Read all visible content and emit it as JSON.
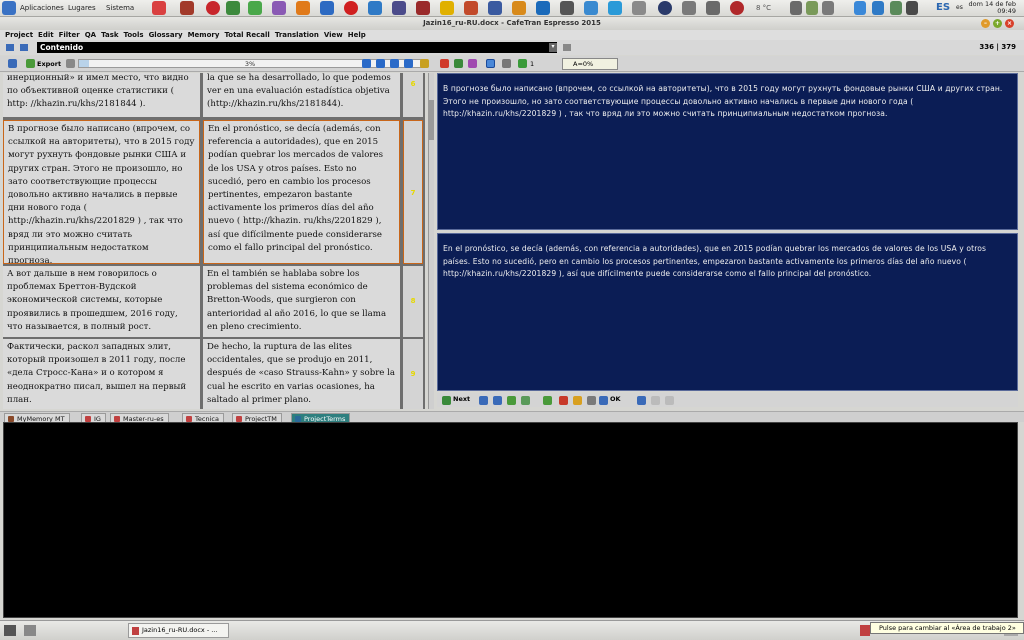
{
  "panel": {
    "menus": [
      "Aplicaciones",
      "Lugares",
      "Sistema"
    ],
    "weather": "8 °C",
    "keyboard": "ES",
    "language": "es",
    "date": "dom 14 de feb",
    "time": "09:49"
  },
  "window": {
    "title": "Jazin16_ru-RU.docx - CafeTran Espresso 2015"
  },
  "menu": [
    "Project",
    "Edit",
    "Filter",
    "QA",
    "Task",
    "Tools",
    "Glossary",
    "Memory",
    "Total Recall",
    "Translation",
    "View",
    "Help"
  ],
  "docbar": {
    "field_value": "Contenido",
    "counter": "336 | 379"
  },
  "toolbar": {
    "export_label": "Export",
    "progress_label": "3%",
    "progress_value": 3,
    "count": "1",
    "tag_label": "A=0%"
  },
  "segments": [
    {
      "num": "6",
      "source": "инерционный» и имел место, что видно по объективной оценке статистики ( http: //khazin.ru/khs/2181844 ).",
      "target": "la que se ha desarrollado, lo que podemos ver en una evaluación estadística objetiva (http://khazin.ru/khs/2181844)."
    },
    {
      "num": "7",
      "source": "В прогнозе было написано (впрочем, со ссылкой на авторитеты), что в 2015 году могут рухнуть фондовые рынки США и других стран. Этого не произошло, но зато соответствующие процессы довольно активно начались в первые дни нового года ( http://khazin.ru/khs/2201829 ) , так что вряд ли это можно считать принципиальным недостатком прогноза.",
      "target": "En el pronóstico, se decía (además, con referencia a autoridades), que en 2015 podían quebrar los mercados de valores de los USA y otros países. Esto no sucedió, pero en cambio los procesos pertinentes, empezaron bastante activamente los primeros días del año nuevo ( http://khazin. ru/khs/2201829 ), así que difícilmente puede considerarse como el fallo principal del pronóstico."
    },
    {
      "num": "8",
      "source": "А вот дальше в нем говорилось о проблемах Бреттон-Вудской экономической системы, которые проявились в прошедшем, 2016 году, что называется, в полный рост.",
      "target": "En el también se hablaba sobre los problemas del sistema económico de Bretton-Woods, que surgieron con anterioridad al año 2016, lo que se llama en pleno crecimiento."
    },
    {
      "num": "9",
      "source": "Фактически, раскол западных элит, который произошел в 2011 году, после «дела Стросс-Кана» и о котором я неоднократно писал, вышел на первый план.",
      "target": "De hecho, la ruptura de las elites occidentales, que se produjo en 2011, después de «caso Strauss-Kahn» y sobre la cual he escrito en varias ocasiones, ha saltado al primer plano."
    }
  ],
  "editor": {
    "source": "В прогнозе было написано (впрочем, со ссылкой на авторитеты), что в 2015 году могут рухнуть фондовые рынки США и других стран. Этого не произошло, но зато соответствующие процессы довольно активно начались в первые дни нового года ( http://khazin.ru/khs/2201829 ) , так что вряд ли это можно считать принципиальным недостатком прогноза.",
    "target": "En el pronóstico, se decía (además, con referencia a autoridades), que en 2015 podían quebrar los mercados de valores de los USA y otros países. Esto no sucedió, pero en cambio los procesos pertinentes, empezaron bastante activamente los primeros días del año nuevo ( http://khazin.ru/khs/2201829 ), así que difícilmente puede considerarse como el fallo principal del pronóstico.",
    "next_label": "Next",
    "ok_label": "OK"
  },
  "tabs": [
    {
      "label": "MyMemory MT",
      "color": "#8a4a2a"
    },
    {
      "label": "IG",
      "color": "#c04040"
    },
    {
      "label": "Master-ru-es",
      "color": "#c04040"
    },
    {
      "label": "Tecnica",
      "color": "#c04040"
    },
    {
      "label": "ProjectTM",
      "color": "#c04040"
    },
    {
      "label": "ProjectTerms",
      "color": "#2a6a9a"
    }
  ],
  "taskbar": {
    "task_label": "Jazin16_ru-RU.docx - ...",
    "tooltip": "Pulse para cambiar al «Área de trabajo 2»"
  }
}
